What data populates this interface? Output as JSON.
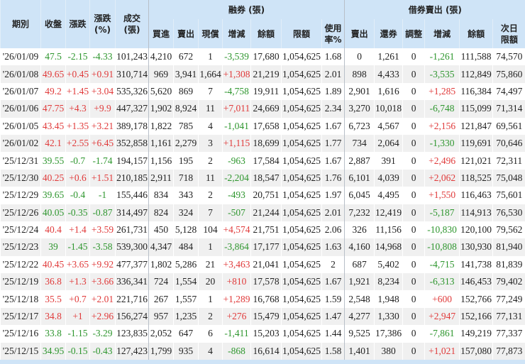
{
  "header": {
    "date": "期別",
    "close": "收盤",
    "change": "漲跌",
    "pct_1": "漲跌",
    "pct_2": "(%)",
    "vol_1": "成交",
    "vol_2": "(張)",
    "short_group": "融券 (張)",
    "short_cols": [
      "買進",
      "賣出",
      "現償",
      "增減",
      "餘額",
      "限額"
    ],
    "usage_1": "使用",
    "usage_2": "率%",
    "sbl_group": "借券賣出 (張)",
    "sbl_cols": [
      "賣出",
      "還券",
      "調整",
      "增減",
      "餘額"
    ],
    "next_1": "次日",
    "next_2": "限額"
  },
  "colors": {
    "up": "#e03a3a",
    "down": "#2e962e"
  },
  "rows": [
    [
      "'26/01/09",
      "47.5",
      "-2.15",
      "-4.33",
      "101,243",
      "4,210",
      "672",
      "1",
      "-3,539",
      "17,680",
      "1,054,625",
      "1.68",
      "0",
      "1,261",
      "0",
      "-1,261",
      "111,588",
      "74,570"
    ],
    [
      "'26/01/08",
      "49.65",
      "+0.45",
      "+0.91",
      "310,714",
      "969",
      "3,941",
      "1,664",
      "+1,308",
      "21,219",
      "1,054,625",
      "2.01",
      "898",
      "4,433",
      "0",
      "-3,535",
      "112,849",
      "75,860"
    ],
    [
      "'26/01/07",
      "49.2",
      "+1.45",
      "+3.04",
      "535,326",
      "5,620",
      "869",
      "7",
      "-4,758",
      "19,911",
      "1,054,625",
      "1.89",
      "2,901",
      "1,616",
      "0",
      "+1,285",
      "116,384",
      "74,497"
    ],
    [
      "'26/01/06",
      "47.75",
      "+4.3",
      "+9.9",
      "447,327",
      "1,902",
      "8,924",
      "11",
      "+7,011",
      "24,669",
      "1,054,625",
      "2.34",
      "3,270",
      "10,018",
      "0",
      "-6,748",
      "115,099",
      "71,314"
    ],
    [
      "'26/01/05",
      "43.45",
      "+1.35",
      "+3.21",
      "389,178",
      "1,822",
      "785",
      "4",
      "-1,041",
      "17,658",
      "1,054,625",
      "1.67",
      "6,723",
      "4,567",
      "0",
      "+2,156",
      "121,847",
      "69,561"
    ],
    [
      "'26/01/02",
      "42.1",
      "+2.55",
      "+6.45",
      "352,858",
      "1,161",
      "2,279",
      "3",
      "+1,115",
      "18,699",
      "1,054,625",
      "1.77",
      "734",
      "2,064",
      "0",
      "-1,330",
      "119,691",
      "70,646"
    ],
    [
      "'25/12/31",
      "39.55",
      "-0.7",
      "-1.74",
      "194,157",
      "1,156",
      "195",
      "2",
      "-963",
      "17,584",
      "1,054,625",
      "1.67",
      "2,887",
      "391",
      "0",
      "+2,496",
      "121,021",
      "72,311"
    ],
    [
      "'25/12/30",
      "40.25",
      "+0.6",
      "+1.51",
      "210,185",
      "2,911",
      "718",
      "11",
      "-2,204",
      "18,547",
      "1,054,625",
      "1.76",
      "6,101",
      "4,039",
      "0",
      "+2,062",
      "118,525",
      "75,048"
    ],
    [
      "'25/12/29",
      "39.65",
      "-0.4",
      "-1",
      "155,446",
      "834",
      "343",
      "2",
      "-493",
      "20,751",
      "1,054,625",
      "1.97",
      "6,045",
      "4,495",
      "0",
      "+1,550",
      "116,463",
      "75,601"
    ],
    [
      "'25/12/26",
      "40.05",
      "-0.35",
      "-0.87",
      "314,497",
      "824",
      "324",
      "7",
      "-507",
      "21,244",
      "1,054,625",
      "2.01",
      "7,232",
      "12,419",
      "0",
      "-5,187",
      "114,913",
      "76,530"
    ],
    [
      "'25/12/24",
      "40.4",
      "+1.4",
      "+3.59",
      "261,731",
      "450",
      "5,128",
      "104",
      "+4,574",
      "21,751",
      "1,054,625",
      "2.06",
      "326",
      "11,156",
      "0",
      "-10,830",
      "120,100",
      "79,562"
    ],
    [
      "'25/12/23",
      "39",
      "-1.45",
      "-3.58",
      "539,300",
      "4,347",
      "484",
      "1",
      "-3,864",
      "17,177",
      "1,054,625",
      "1.63",
      "4,160",
      "14,968",
      "0",
      "-10,808",
      "130,930",
      "81,940"
    ],
    [
      "'25/12/22",
      "40.45",
      "+3.65",
      "+9.92",
      "477,377",
      "1,802",
      "5,286",
      "21",
      "+3,463",
      "21,041",
      "1,054,625",
      "2",
      "687",
      "5,402",
      "0",
      "-4,715",
      "141,738",
      "81,839"
    ],
    [
      "'25/12/19",
      "36.8",
      "+1.3",
      "+3.66",
      "336,341",
      "724",
      "1,554",
      "20",
      "+810",
      "17,578",
      "1,054,625",
      "1.67",
      "1,921",
      "8,234",
      "0",
      "-6,313",
      "146,453",
      "79,402"
    ],
    [
      "'25/12/18",
      "35.5",
      "+0.7",
      "+2.01",
      "221,716",
      "267",
      "1,557",
      "1",
      "+1,289",
      "16,768",
      "1,054,625",
      "1.59",
      "2,548",
      "1,948",
      "0",
      "+600",
      "152,766",
      "77,249"
    ],
    [
      "'25/12/17",
      "34.8",
      "+1",
      "+2.96",
      "156,274",
      "957",
      "1,235",
      "2",
      "+276",
      "15,479",
      "1,054,625",
      "1.47",
      "4,277",
      "1,330",
      "0",
      "+2,947",
      "152,166",
      "77,131"
    ],
    [
      "'25/12/16",
      "33.8",
      "-1.15",
      "-3.29",
      "123,835",
      "2,052",
      "647",
      "6",
      "-1,411",
      "15,203",
      "1,054,625",
      "1.44",
      "9,525",
      "17,386",
      "0",
      "-7,861",
      "149,219",
      "77,337"
    ],
    [
      "'25/12/15",
      "34.95",
      "-0.15",
      "-0.43",
      "127,423",
      "1,799",
      "935",
      "4",
      "-868",
      "16,614",
      "1,054,625",
      "1.58",
      "1,401",
      "380",
      "0",
      "+1,021",
      "157,080",
      "77,873"
    ]
  ]
}
